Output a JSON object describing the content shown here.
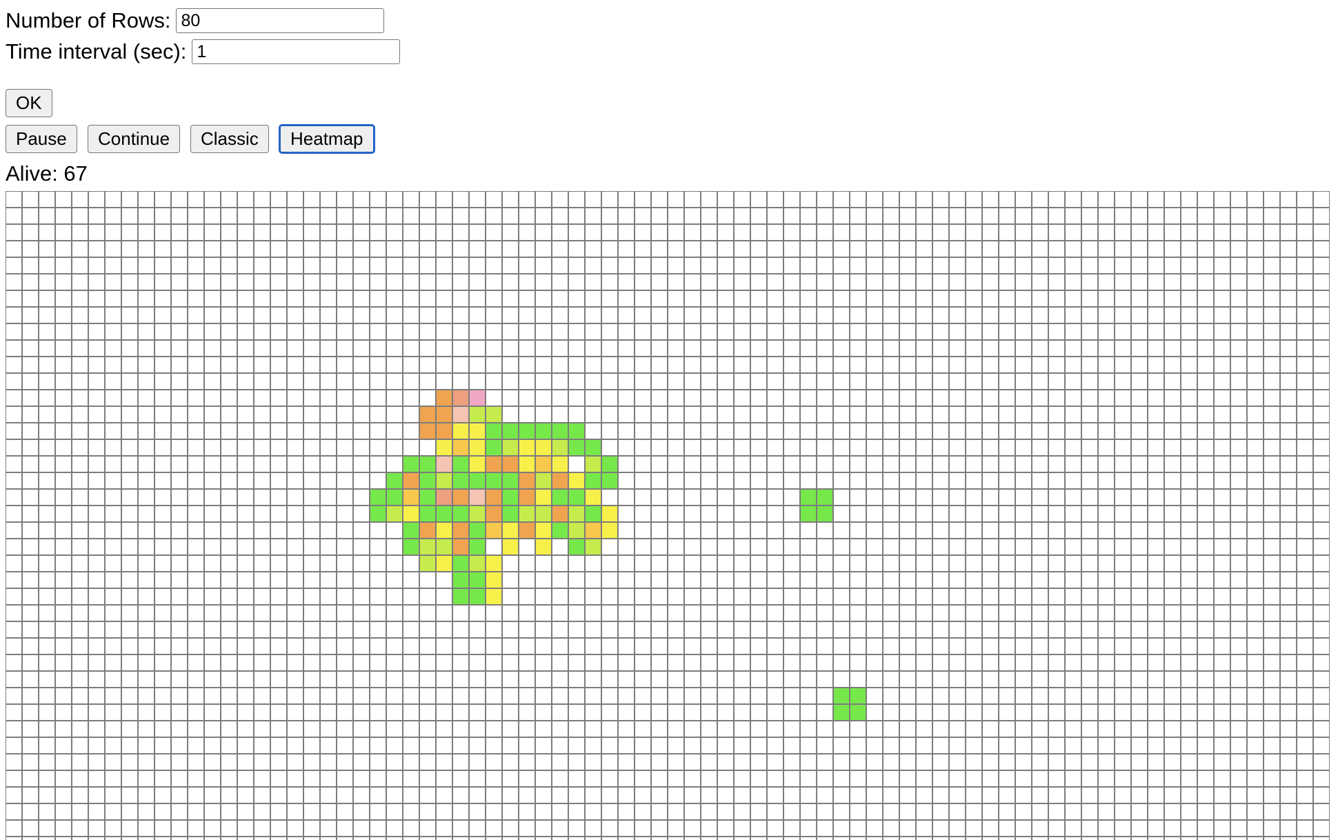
{
  "form": {
    "rows_label": "Number of Rows:",
    "rows_value": "80",
    "interval_label": "Time interval (sec):",
    "interval_value": "1",
    "ok_label": "OK"
  },
  "controls": {
    "pause_label": "Pause",
    "continue_label": "Continue",
    "classic_label": "Classic",
    "heatmap_label": "Heatmap",
    "focused": "heatmap"
  },
  "status": {
    "alive_text": "Alive: 67"
  },
  "grid": {
    "columns": 80,
    "visible_rows": 40,
    "palette": {
      "empty": "#ffffff",
      "border": "#7c7c7c",
      "G": "#77e84a",
      "L": "#c6eb4d",
      "Y": "#f8f04a",
      "A": "#f7c84c",
      "O": "#f0a450",
      "S": "#ed9f7e",
      "P": "#f6c4b3",
      "M": "#f0a7c3"
    },
    "colored_cells": [
      {
        "row": 12,
        "col": 26,
        "c": "O"
      },
      {
        "row": 12,
        "col": 27,
        "c": "S"
      },
      {
        "row": 12,
        "col": 28,
        "c": "M"
      },
      {
        "row": 13,
        "col": 25,
        "c": "O"
      },
      {
        "row": 13,
        "col": 26,
        "c": "O"
      },
      {
        "row": 13,
        "col": 27,
        "c": "P"
      },
      {
        "row": 13,
        "col": 28,
        "c": "L"
      },
      {
        "row": 13,
        "col": 29,
        "c": "L"
      },
      {
        "row": 14,
        "col": 25,
        "c": "O"
      },
      {
        "row": 14,
        "col": 26,
        "c": "O"
      },
      {
        "row": 14,
        "col": 27,
        "c": "Y"
      },
      {
        "row": 14,
        "col": 28,
        "c": "Y"
      },
      {
        "row": 14,
        "col": 29,
        "c": "G"
      },
      {
        "row": 14,
        "col": 30,
        "c": "G"
      },
      {
        "row": 14,
        "col": 31,
        "c": "G"
      },
      {
        "row": 14,
        "col": 32,
        "c": "G"
      },
      {
        "row": 14,
        "col": 33,
        "c": "G"
      },
      {
        "row": 14,
        "col": 34,
        "c": "G"
      },
      {
        "row": 15,
        "col": 26,
        "c": "Y"
      },
      {
        "row": 15,
        "col": 27,
        "c": "A"
      },
      {
        "row": 15,
        "col": 28,
        "c": "Y"
      },
      {
        "row": 15,
        "col": 29,
        "c": "G"
      },
      {
        "row": 15,
        "col": 30,
        "c": "L"
      },
      {
        "row": 15,
        "col": 31,
        "c": "Y"
      },
      {
        "row": 15,
        "col": 32,
        "c": "Y"
      },
      {
        "row": 15,
        "col": 33,
        "c": "L"
      },
      {
        "row": 15,
        "col": 34,
        "c": "G"
      },
      {
        "row": 15,
        "col": 35,
        "c": "G"
      },
      {
        "row": 16,
        "col": 24,
        "c": "G"
      },
      {
        "row": 16,
        "col": 25,
        "c": "G"
      },
      {
        "row": 16,
        "col": 26,
        "c": "P"
      },
      {
        "row": 16,
        "col": 27,
        "c": "G"
      },
      {
        "row": 16,
        "col": 28,
        "c": "Y"
      },
      {
        "row": 16,
        "col": 29,
        "c": "O"
      },
      {
        "row": 16,
        "col": 30,
        "c": "O"
      },
      {
        "row": 16,
        "col": 31,
        "c": "Y"
      },
      {
        "row": 16,
        "col": 32,
        "c": "A"
      },
      {
        "row": 16,
        "col": 33,
        "c": "Y"
      },
      {
        "row": 16,
        "col": 35,
        "c": "L"
      },
      {
        "row": 16,
        "col": 36,
        "c": "G"
      },
      {
        "row": 17,
        "col": 23,
        "c": "G"
      },
      {
        "row": 17,
        "col": 24,
        "c": "O"
      },
      {
        "row": 17,
        "col": 25,
        "c": "G"
      },
      {
        "row": 17,
        "col": 26,
        "c": "L"
      },
      {
        "row": 17,
        "col": 27,
        "c": "G"
      },
      {
        "row": 17,
        "col": 28,
        "c": "G"
      },
      {
        "row": 17,
        "col": 29,
        "c": "G"
      },
      {
        "row": 17,
        "col": 30,
        "c": "G"
      },
      {
        "row": 17,
        "col": 31,
        "c": "O"
      },
      {
        "row": 17,
        "col": 32,
        "c": "L"
      },
      {
        "row": 17,
        "col": 33,
        "c": "O"
      },
      {
        "row": 17,
        "col": 34,
        "c": "Y"
      },
      {
        "row": 17,
        "col": 35,
        "c": "G"
      },
      {
        "row": 17,
        "col": 36,
        "c": "G"
      },
      {
        "row": 18,
        "col": 22,
        "c": "G"
      },
      {
        "row": 18,
        "col": 23,
        "c": "G"
      },
      {
        "row": 18,
        "col": 24,
        "c": "A"
      },
      {
        "row": 18,
        "col": 25,
        "c": "G"
      },
      {
        "row": 18,
        "col": 26,
        "c": "S"
      },
      {
        "row": 18,
        "col": 27,
        "c": "O"
      },
      {
        "row": 18,
        "col": 28,
        "c": "P"
      },
      {
        "row": 18,
        "col": 29,
        "c": "O"
      },
      {
        "row": 18,
        "col": 30,
        "c": "G"
      },
      {
        "row": 18,
        "col": 31,
        "c": "O"
      },
      {
        "row": 18,
        "col": 32,
        "c": "Y"
      },
      {
        "row": 18,
        "col": 33,
        "c": "G"
      },
      {
        "row": 18,
        "col": 34,
        "c": "G"
      },
      {
        "row": 18,
        "col": 35,
        "c": "Y"
      },
      {
        "row": 18,
        "col": 48,
        "c": "G"
      },
      {
        "row": 18,
        "col": 49,
        "c": "G"
      },
      {
        "row": 19,
        "col": 22,
        "c": "G"
      },
      {
        "row": 19,
        "col": 23,
        "c": "L"
      },
      {
        "row": 19,
        "col": 24,
        "c": "Y"
      },
      {
        "row": 19,
        "col": 25,
        "c": "G"
      },
      {
        "row": 19,
        "col": 26,
        "c": "G"
      },
      {
        "row": 19,
        "col": 27,
        "c": "G"
      },
      {
        "row": 19,
        "col": 28,
        "c": "L"
      },
      {
        "row": 19,
        "col": 29,
        "c": "O"
      },
      {
        "row": 19,
        "col": 30,
        "c": "G"
      },
      {
        "row": 19,
        "col": 31,
        "c": "L"
      },
      {
        "row": 19,
        "col": 32,
        "c": "L"
      },
      {
        "row": 19,
        "col": 33,
        "c": "O"
      },
      {
        "row": 19,
        "col": 34,
        "c": "L"
      },
      {
        "row": 19,
        "col": 35,
        "c": "G"
      },
      {
        "row": 19,
        "col": 36,
        "c": "Y"
      },
      {
        "row": 19,
        "col": 48,
        "c": "G"
      },
      {
        "row": 19,
        "col": 49,
        "c": "G"
      },
      {
        "row": 20,
        "col": 24,
        "c": "G"
      },
      {
        "row": 20,
        "col": 25,
        "c": "O"
      },
      {
        "row": 20,
        "col": 26,
        "c": "Y"
      },
      {
        "row": 20,
        "col": 27,
        "c": "O"
      },
      {
        "row": 20,
        "col": 28,
        "c": "G"
      },
      {
        "row": 20,
        "col": 29,
        "c": "A"
      },
      {
        "row": 20,
        "col": 30,
        "c": "Y"
      },
      {
        "row": 20,
        "col": 31,
        "c": "O"
      },
      {
        "row": 20,
        "col": 32,
        "c": "Y"
      },
      {
        "row": 20,
        "col": 33,
        "c": "G"
      },
      {
        "row": 20,
        "col": 34,
        "c": "L"
      },
      {
        "row": 20,
        "col": 35,
        "c": "A"
      },
      {
        "row": 20,
        "col": 36,
        "c": "Y"
      },
      {
        "row": 21,
        "col": 24,
        "c": "G"
      },
      {
        "row": 21,
        "col": 25,
        "c": "L"
      },
      {
        "row": 21,
        "col": 26,
        "c": "L"
      },
      {
        "row": 21,
        "col": 27,
        "c": "O"
      },
      {
        "row": 21,
        "col": 28,
        "c": "G"
      },
      {
        "row": 21,
        "col": 30,
        "c": "Y"
      },
      {
        "row": 21,
        "col": 32,
        "c": "Y"
      },
      {
        "row": 21,
        "col": 34,
        "c": "G"
      },
      {
        "row": 21,
        "col": 35,
        "c": "L"
      },
      {
        "row": 22,
        "col": 25,
        "c": "L"
      },
      {
        "row": 22,
        "col": 26,
        "c": "Y"
      },
      {
        "row": 22,
        "col": 27,
        "c": "G"
      },
      {
        "row": 22,
        "col": 28,
        "c": "L"
      },
      {
        "row": 22,
        "col": 29,
        "c": "Y"
      },
      {
        "row": 23,
        "col": 27,
        "c": "G"
      },
      {
        "row": 23,
        "col": 28,
        "c": "G"
      },
      {
        "row": 23,
        "col": 29,
        "c": "Y"
      },
      {
        "row": 24,
        "col": 27,
        "c": "G"
      },
      {
        "row": 24,
        "col": 28,
        "c": "G"
      },
      {
        "row": 24,
        "col": 29,
        "c": "Y"
      },
      {
        "row": 30,
        "col": 50,
        "c": "G"
      },
      {
        "row": 30,
        "col": 51,
        "c": "G"
      },
      {
        "row": 31,
        "col": 50,
        "c": "G"
      },
      {
        "row": 31,
        "col": 51,
        "c": "G"
      }
    ]
  }
}
